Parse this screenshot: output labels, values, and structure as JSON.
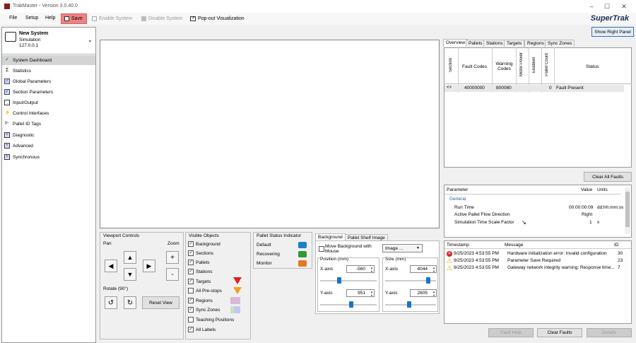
{
  "window": {
    "title": "TrakMaster - Version 3.0.40.0"
  },
  "menu": [
    "File",
    "Setup",
    "Help"
  ],
  "toolbar": {
    "save": "Save",
    "enable": "Enable System",
    "disable": "Disable System",
    "popout": "Pop-out Visualization",
    "brand": "SuperTrak",
    "show_right": "Show Right Panel"
  },
  "system": {
    "name": "New System",
    "mode": "Simulation",
    "ip": "127.0.0.1"
  },
  "nav": [
    {
      "label": "System Dashboard",
      "icon": "dashboard-icon"
    },
    {
      "label": "Statistics",
      "icon": "sigma-icon"
    },
    {
      "label": "Global Parameters",
      "icon": "checklist-icon"
    },
    {
      "label": "Section Parameters",
      "icon": "checklist-icon"
    },
    {
      "label": "Input/Output",
      "icon": "io-icon"
    },
    {
      "label": "Control Interfaces",
      "icon": "control-icon"
    },
    {
      "label": "Pallet ID Tags",
      "icon": "tag-icon"
    },
    {
      "label": "Diagnostic",
      "icon": "expand-icon"
    },
    {
      "label": "Advanced",
      "icon": "expand-icon"
    },
    {
      "label": "Synchronous",
      "icon": "expand-icon"
    }
  ],
  "viewport": {
    "title": "Viewport Controls",
    "pan": "Pan",
    "zoom": "Zoom",
    "zoom_in": "+",
    "zoom_out": "-",
    "rotate": "Rotate (90°)",
    "reset": "Reset View"
  },
  "visible": {
    "title": "Visible Objects",
    "items": [
      {
        "label": "Background",
        "checked": true
      },
      {
        "label": "Sections",
        "checked": true
      },
      {
        "label": "Pallets",
        "checked": true
      },
      {
        "label": "Stations",
        "checked": true
      },
      {
        "label": "Targets",
        "checked": true
      },
      {
        "label": "All Pre-stops",
        "checked": false
      },
      {
        "label": "Regions",
        "checked": true
      },
      {
        "label": "Sync Zones",
        "checked": true
      },
      {
        "label": "Teaching Positions",
        "checked": false
      },
      {
        "label": "All Labels",
        "checked": true
      }
    ]
  },
  "pallet_status": {
    "title": "Pallet Status Indicator",
    "items": [
      {
        "label": "Default",
        "color": "#1e7fc8"
      },
      {
        "label": "Recovering",
        "color": "#2e9a3a"
      },
      {
        "label": "Monitor",
        "color": "#e07a20"
      }
    ]
  },
  "background": {
    "tab1": "Background",
    "tab2": "Pallet Shelf Image",
    "move_label": "Move Background with Mouse",
    "image_btn": "Image ...",
    "position_title": "Position (mm)",
    "size_title": "Size (mm)",
    "xaxis": "X-axis",
    "yaxis": "Y-axis",
    "pos_x": "-560",
    "pos_y": "951",
    "size_x": "4044",
    "size_y": "2605"
  },
  "right_tabs": [
    "Overview",
    "Pallets",
    "Stations",
    "Targets",
    "Regions",
    "Sync Zones"
  ],
  "overview": {
    "cols": [
      "Section",
      "Fault Codes",
      "Warning Codes",
      "Motor Power",
      "Enabled",
      "Pallet Count",
      "Status"
    ],
    "row": {
      "section": "<>",
      "fault": "40000000",
      "warning": "800080",
      "count": "0",
      "status": "Fault Present"
    },
    "clear_all": "Clear All Faults"
  },
  "params": {
    "col_param": "Parameter",
    "col_value": "Value",
    "col_units": "Units",
    "group": "General",
    "rows": [
      {
        "name": "Run Time",
        "value": "00:00:00:09",
        "units": "dd:hh:mm:ss"
      },
      {
        "name": "Active Pallet Flow Direction",
        "value": "Right",
        "units": ""
      },
      {
        "name": "Simulation Time Scale Factor",
        "value": "1",
        "units": "x"
      }
    ]
  },
  "messages": {
    "col_ts": "Timestamp",
    "col_msg": "Message",
    "col_id": "ID",
    "rows": [
      {
        "ts": "9/25/2023 4:53:55 PM",
        "msg": "Hardware initialization error: Invalid configuration",
        "id": "30",
        "type": "error"
      },
      {
        "ts": "9/25/2023 4:53:55 PM",
        "msg": "Parameter Save Required",
        "id": "23",
        "type": "warning"
      },
      {
        "ts": "9/25/2023 4:53:55 PM",
        "msg": "Gateway network integrity warning: Response time...",
        "id": "7",
        "type": "warning"
      }
    ]
  },
  "bottom_buttons": {
    "fault_help": "Fault Help",
    "clear_faults": "Clear Faults",
    "details": "Details"
  }
}
